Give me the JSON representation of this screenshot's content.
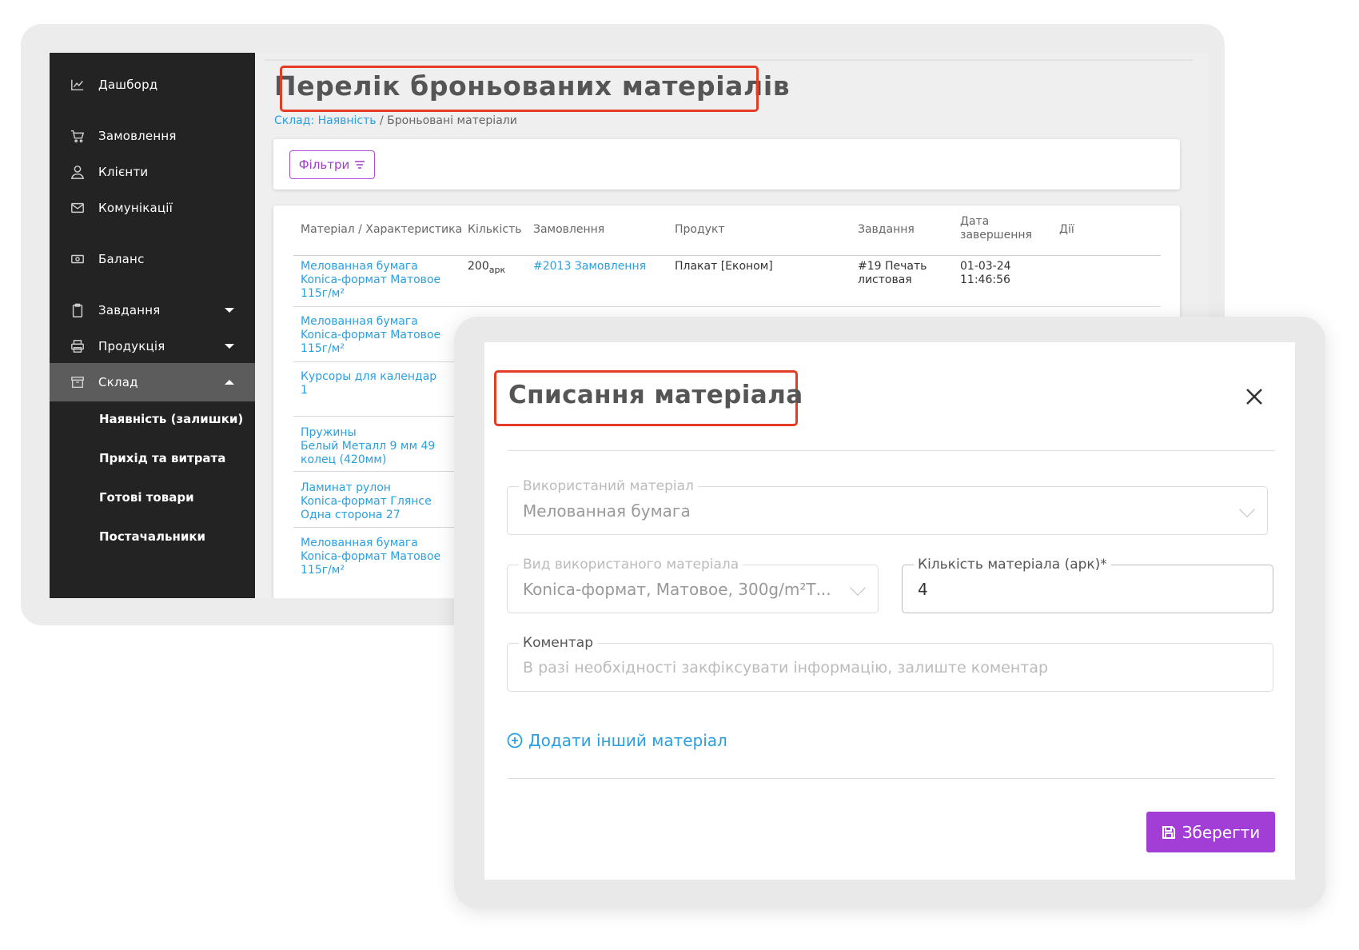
{
  "sidebar": {
    "items": [
      {
        "label": "Дашборд",
        "icon": "chart-icon"
      },
      {
        "label": "Замовлення",
        "icon": "cart-icon"
      },
      {
        "label": "Клієнти",
        "icon": "user-icon"
      },
      {
        "label": "Комунікації",
        "icon": "mail-icon"
      },
      {
        "label": "Баланс",
        "icon": "cash-icon"
      },
      {
        "label": "Завдання",
        "icon": "clipboard-icon",
        "expanded": false
      },
      {
        "label": "Продукція",
        "icon": "printer-icon",
        "expanded": false
      },
      {
        "label": "Склад",
        "icon": "archive-icon",
        "expanded": true
      }
    ],
    "sub_items": [
      "Наявність (залишки)",
      "Прихід та витрата",
      "Готові товари",
      "Постачальники"
    ]
  },
  "page": {
    "title": "Перелік броньованих матеріалів",
    "breadcrumb_link": "Склад: Наявність",
    "breadcrumb_sep": " / ",
    "breadcrumb_current": "Броньовані матеріали",
    "filter_label": "Фільтри"
  },
  "table": {
    "headers": {
      "material": "Матеріал / Характеристика",
      "quantity": "Кількість",
      "order": "Замовлення",
      "product": "Продукт",
      "task": "Завдання",
      "date_l1": "Дата",
      "date_l2": "завершення",
      "actions": "Дії"
    },
    "rows": [
      {
        "m1": "Мелованная бумага",
        "m2": "Konica-формат Матовое",
        "m3": "115г/м²",
        "qty": "200",
        "unit": "арк",
        "order": "#2013 Замовлення",
        "product": "Плакат [Економ]",
        "task1": "#19 Печать",
        "task2": "листовая",
        "date1": "01-03-24",
        "date2": "11:46:56"
      },
      {
        "m1": "Мелованная бумага",
        "m2": "Konica-формат Матовое",
        "m3": "115г/м²"
      },
      {
        "m1": "Курсоры для календар",
        "m2": "1",
        "m3": ""
      },
      {
        "m1": "Пружины",
        "m2": "Белый Металл 9 мм 49",
        "m3": "колец (420мм)"
      },
      {
        "m1": "Ламинат рулон",
        "m2": "Konica-формат Глянсе",
        "m3": "Одна сторона 27"
      },
      {
        "m1": "Мелованная бумага",
        "m2": "Konica-формат Матовое",
        "m3": "115г/м²"
      }
    ]
  },
  "modal": {
    "title": "Списання матеріала",
    "used_material_label": "Використаний матеріал",
    "used_material_value": "Мелованная бумага",
    "material_kind_label": "Вид використаного матеріала",
    "material_kind_value": "Konica-формат, Матовое, 300g/m²Т...",
    "quantity_label": "Кількість матеріала (арк)*",
    "quantity_value": "4",
    "comment_label": "Коментар",
    "comment_placeholder": "В разі необхідності закфіксувати інформацію, залиште коментар",
    "add_material_label": "Додати інший матеріал",
    "save_label": "Зберегти"
  },
  "colors": {
    "sidebar_bg": "#232323",
    "sidebar_active": "#5c5c5c",
    "link": "#2a9fe0",
    "accent_purple": "#a23ed6",
    "highlight_red": "#e53a25"
  }
}
